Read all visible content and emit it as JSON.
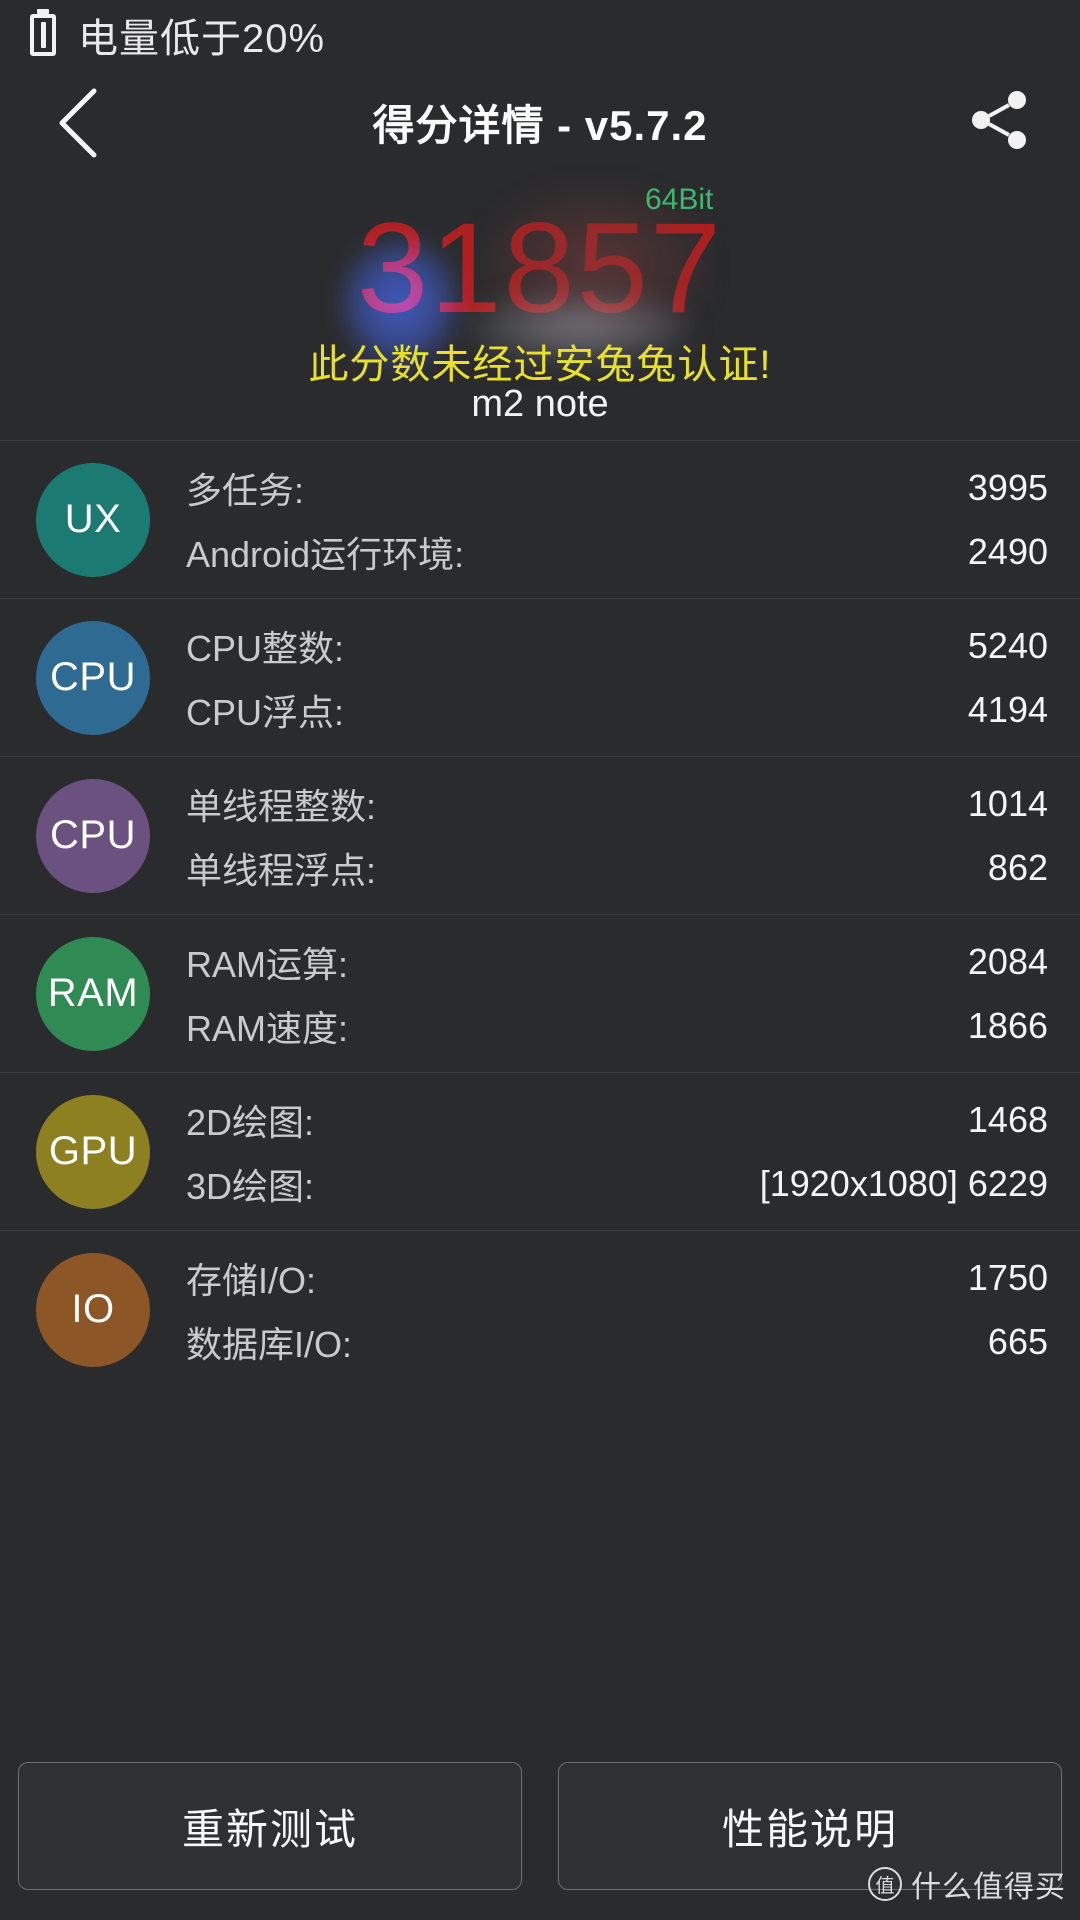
{
  "status_bar": {
    "battery_icon": "battery-alert-icon",
    "warning_text": "电量低于20%"
  },
  "header": {
    "back_icon": "back-chevron-icon",
    "title": "得分详情 - v5.7.2",
    "share_icon": "share-icon"
  },
  "hero": {
    "score": "31857",
    "bit_badge": "64Bit",
    "uncertified_notice": "此分数未经过安兔兔认证!",
    "device_name": "m2 note",
    "score_color": "#b01f1f",
    "bit_badge_color": "#3fb86e",
    "uncertified_color": "#e8e02a"
  },
  "sections": [
    {
      "badge": "UX",
      "badge_color": "#1b7a72",
      "rows": [
        {
          "label": "多任务:",
          "value": "3995"
        },
        {
          "label": "Android运行环境:",
          "value": "2490"
        }
      ]
    },
    {
      "badge": "CPU",
      "badge_color": "#2e6a92",
      "rows": [
        {
          "label": "CPU整数:",
          "value": "5240"
        },
        {
          "label": "CPU浮点:",
          "value": "4194"
        }
      ]
    },
    {
      "badge": "CPU",
      "badge_color": "#6b5180",
      "rows": [
        {
          "label": "单线程整数:",
          "value": "1014"
        },
        {
          "label": "单线程浮点:",
          "value": "862"
        }
      ]
    },
    {
      "badge": "RAM",
      "badge_color": "#2f8a53",
      "rows": [
        {
          "label": "RAM运算:",
          "value": "2084"
        },
        {
          "label": "RAM速度:",
          "value": "1866"
        }
      ]
    },
    {
      "badge": "GPU",
      "badge_color": "#8d8021",
      "rows": [
        {
          "label": "2D绘图:",
          "value": "1468"
        },
        {
          "label": "3D绘图:",
          "value": "[1920x1080] 6229"
        }
      ]
    },
    {
      "badge": "IO",
      "badge_color": "#8c5627",
      "rows": [
        {
          "label": "存储I/O:",
          "value": "1750"
        },
        {
          "label": "数据库I/O:",
          "value": "665"
        }
      ]
    }
  ],
  "footer": {
    "retest_label": "重新测试",
    "performance_label": "性能说明"
  },
  "watermark": {
    "mark": "值",
    "text": "什么值得买"
  }
}
